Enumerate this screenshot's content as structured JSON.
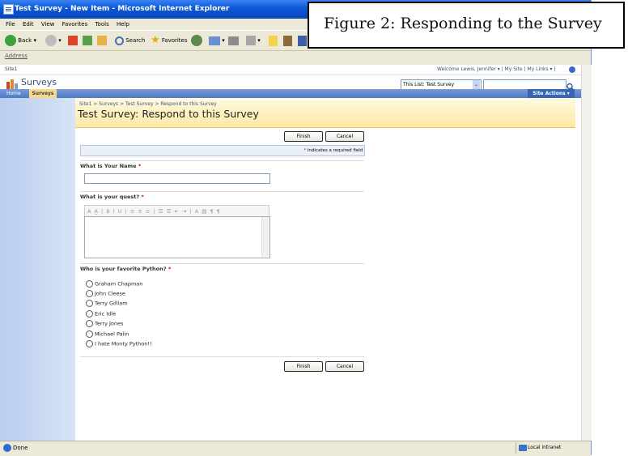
{
  "window": {
    "title": "Test Survey - New Item - Microsoft Internet Explorer"
  },
  "menu": [
    "File",
    "Edit",
    "View",
    "Favorites",
    "Tools",
    "Help"
  ],
  "toolbar": {
    "back": "Back",
    "search": "Search",
    "favorites": "Favorites"
  },
  "address": {
    "label": "Address"
  },
  "globalbar": {
    "site": "Site1",
    "right": "Welcome Lewis, Jennifer ▾  |  My Site  |  My Links ▾  |"
  },
  "site": {
    "title": "Surveys",
    "scope": "This List: Test Survey"
  },
  "nav": {
    "home": "Home",
    "surveys": "Surveys",
    "site_actions": "Site Actions ▾"
  },
  "breadcrumb": "Site1 > Surveys > Test Survey > Respond to this Survey",
  "page_title": "Test Survey: Respond to this Survey",
  "buttons": {
    "finish": "Finish",
    "cancel": "Cancel"
  },
  "required_note": {
    "star": "*",
    "text": " indicates a required field"
  },
  "questions": [
    {
      "label": "What is Your Name",
      "star": "*"
    },
    {
      "label": "What is your quest?",
      "star": "*"
    },
    {
      "label": "Who is your favorite Python?",
      "star": "*"
    }
  ],
  "rte_toolbar": "A A̲ | B I U | ≡ ≡ ≡ | ☰ ☰ ⇤ ⇥ | A ▤ ¶ ¶",
  "options": [
    "Graham Chapman",
    "John Cleese",
    "Terry Gilliam",
    "Eric Idle",
    "Terry Jones",
    "Michael Palin",
    "I hate Monty Python!!"
  ],
  "status": {
    "left": "Done",
    "zone": "Local intranet"
  },
  "caption": "Figure 2: Responding to the Survey"
}
